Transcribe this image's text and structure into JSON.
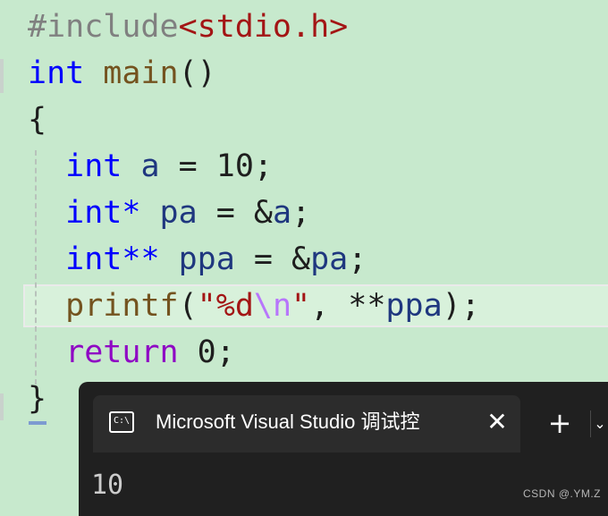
{
  "editor": {
    "lines": {
      "include": {
        "directive": "#include",
        "header": "<stdio.h>"
      },
      "main_sig": {
        "type": "int",
        "name": "main",
        "parens": "()"
      },
      "open_brace": "{",
      "decl_a": {
        "type": "int",
        "name": "a",
        "rest": " = 10;"
      },
      "decl_pa": {
        "type": "int*",
        "name": "pa",
        "mid": " = &",
        "target": "a",
        "end": ";"
      },
      "decl_ppa": {
        "type": "int**",
        "name": "ppa",
        "mid": " = &",
        "target": "pa",
        "end": ";"
      },
      "printf_call": {
        "fn": "printf",
        "open": "(",
        "str_start": "\"%d",
        "escape": "\\n",
        "str_end": "\"",
        "mid": ", **",
        "arg": "ppa",
        "end": ");"
      },
      "return_stmt": {
        "kw": "return",
        "rest": " 0;"
      },
      "close_brace": "}"
    }
  },
  "terminal": {
    "tab_icon_text": "C:\\",
    "tab_title": "Microsoft Visual Studio 调试控",
    "close_glyph": "✕",
    "new_tab_glyph": "+",
    "dropdown_glyph": "⌄",
    "output": "10"
  },
  "watermark": "CSDN @.YM.Z",
  "icons": {
    "tab_icon": "terminal-icon",
    "close": "close-icon",
    "new_tab": "plus-icon",
    "dropdown": "chevron-down-icon"
  },
  "colors": {
    "editor_background": "#c7e9cd",
    "keyword": "#0000ff",
    "string": "#a31515",
    "terminal_background": "#202020"
  }
}
